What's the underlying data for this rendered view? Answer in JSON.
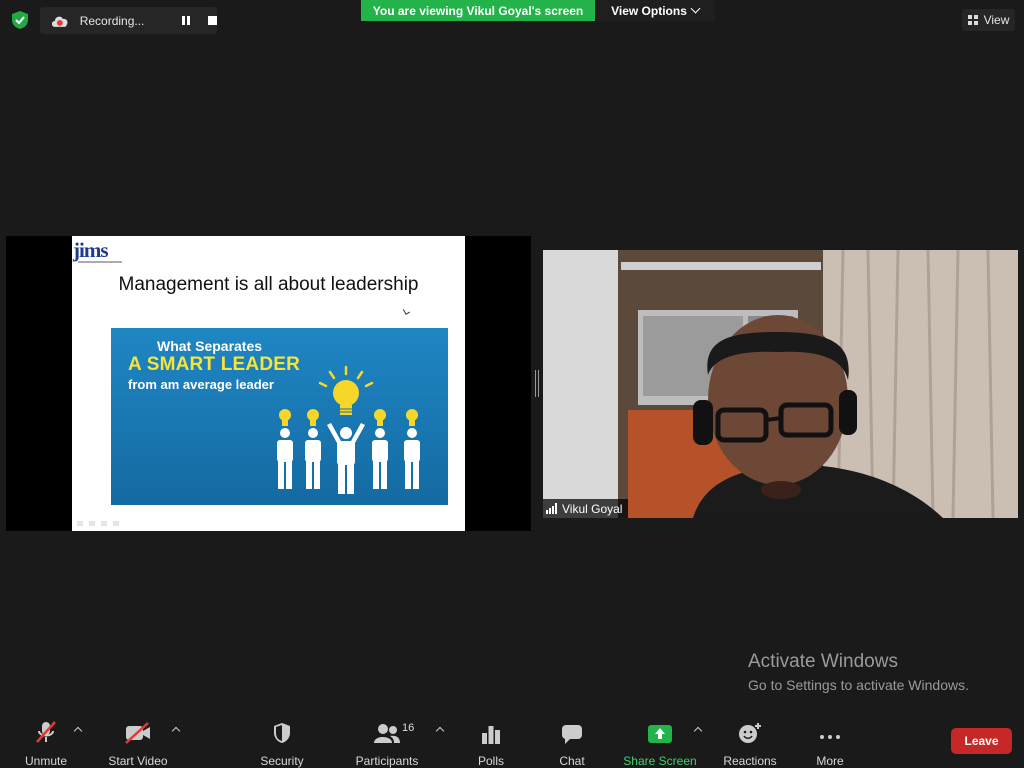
{
  "recording": {
    "label": "Recording..."
  },
  "banner": {
    "viewing_text": "You are viewing Vikul Goyal's screen",
    "view_options_label": "View Options"
  },
  "view_button": {
    "label": "View"
  },
  "slide": {
    "logo_text": "jims",
    "title": "Management is all about leadership",
    "image_line1": "What Separates",
    "image_line2": "A SMART LEADER",
    "image_line3": "from am average leader"
  },
  "video": {
    "participant_name": "Vikul Goyal"
  },
  "watermark": {
    "title": "Activate Windows",
    "subtitle": "Go to Settings to activate Windows."
  },
  "toolbar": {
    "unmute": "Unmute",
    "start_video": "Start Video",
    "security": "Security",
    "participants": "Participants",
    "participants_count": "16",
    "polls": "Polls",
    "chat": "Chat",
    "share_screen": "Share Screen",
    "reactions": "Reactions",
    "more": "More",
    "leave": "Leave"
  },
  "colors": {
    "green": "#24b24a",
    "leave_red": "#c62828",
    "background": "#1a1a1a"
  },
  "icons": [
    "shield-check-icon",
    "cloud-recording-icon",
    "pause-icon",
    "stop-icon",
    "grid-view-icon",
    "mic-muted-icon",
    "video-off-icon",
    "security-shield-icon",
    "participants-icon",
    "polls-icon",
    "chat-icon",
    "share-screen-icon",
    "reactions-icon",
    "more-icon",
    "signal-icon"
  ]
}
